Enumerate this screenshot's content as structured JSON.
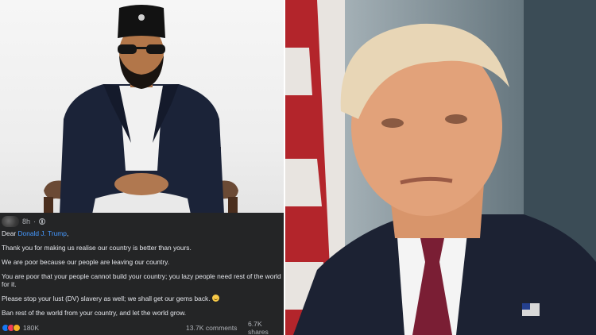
{
  "post": {
    "timestamp": "8h",
    "greeting_prefix": "Dear ",
    "mention": "Donald J. Trump",
    "greeting_suffix": ",",
    "paragraphs": [
      "Thank you for making us realise our country is better than yours.",
      "We are poor because our people are leaving our country.",
      "You are poor that your people cannot build your country; you lazy people need rest of the world for it.",
      "Please stop your lust (DV) slavery as well; we shall get our gems back. ",
      "Ban rest of the world from your country, and let the world grow."
    ],
    "reaction_count": "180K",
    "comments": "13.7K comments",
    "shares": "6.7K shares"
  },
  "colors": {
    "fb_background": "#242526",
    "fb_text": "#e4e6eb",
    "fb_mention": "#4599ff",
    "fb_secondary": "#b0b3b8"
  },
  "icons": [
    "globe-icon",
    "smile-emoji",
    "like-icon",
    "love-icon",
    "care-icon"
  ]
}
